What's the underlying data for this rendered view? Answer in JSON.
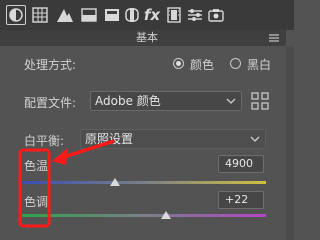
{
  "tabs": [
    {
      "icon": "basic-adjust-icon"
    },
    {
      "icon": "curve-grid-icon"
    },
    {
      "icon": "mountain-peaks-icon"
    },
    {
      "icon": "split-rect-icon"
    },
    {
      "icon": "rect-filled-icon"
    },
    {
      "icon": "lens-icon"
    },
    {
      "icon": "fx-icon",
      "text": "fx"
    },
    {
      "icon": "film-strip-icon"
    },
    {
      "icon": "sliders-icon"
    },
    {
      "icon": "camera-calibration-icon"
    }
  ],
  "section_title": "基本",
  "treatment": {
    "label": "处理方式:",
    "options": [
      "颜色",
      "黑白"
    ],
    "selected": "颜色"
  },
  "profile": {
    "label": "配置文件:",
    "value": "Adobe 颜色"
  },
  "white_balance": {
    "label": "白平衡:",
    "value": "原照设置"
  },
  "temperature": {
    "label": "色温",
    "value": "4900",
    "level": 0.38
  },
  "tint": {
    "label": "色调",
    "value": "+22",
    "level": 0.59
  },
  "colors": {
    "annotation": "#ff1a1a",
    "accent": "#e0e0e0"
  }
}
